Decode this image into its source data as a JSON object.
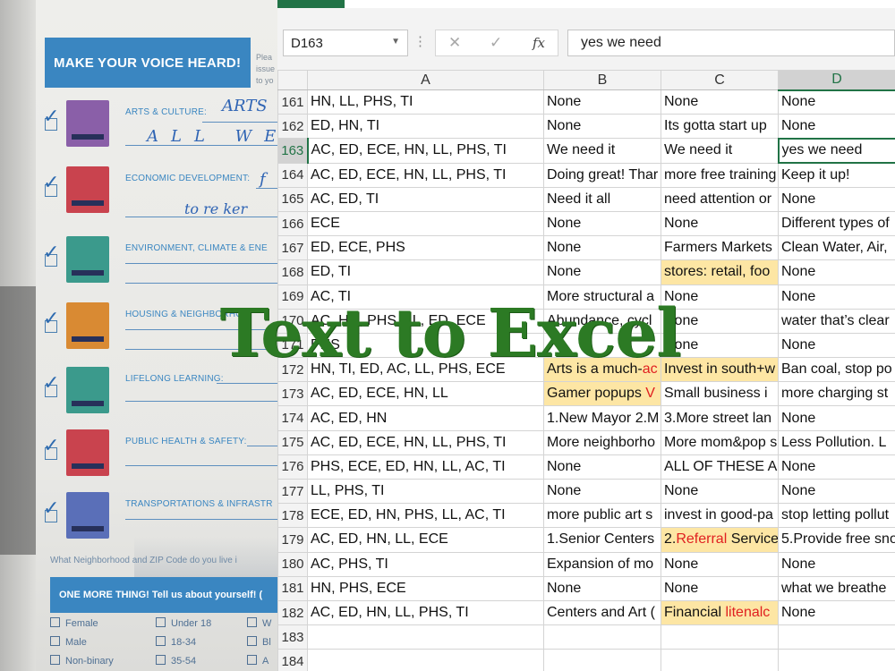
{
  "form": {
    "header": "MAKE YOUR VOICE HEARD!",
    "header_note": [
      "Plea",
      "issue",
      "to yo"
    ],
    "categories": [
      {
        "label": "ARTS & CULTURE:",
        "color": "#8a5fa8",
        "handwriting": [
          "ARTS",
          "ALL WE"
        ]
      },
      {
        "label": "ECONOMIC DEVELOPMENT:",
        "color": "#c9434e",
        "handwriting": [
          "f",
          "to re ker"
        ]
      },
      {
        "label": "ENVIRONMENT, CLIMATE & ENE",
        "color": "#3b9a8c",
        "handwriting": []
      },
      {
        "label": "HOUSING & NEIGHBORHOO",
        "color": "#d98a33",
        "handwriting": []
      },
      {
        "label": "LIFELONG LEARNING:",
        "color": "#3b9a8c",
        "handwriting": []
      },
      {
        "label": "PUBLIC HEALTH & SAFETY:",
        "color": "#c9434e",
        "handwriting": []
      },
      {
        "label": "TRANSPORTATIONS & INFRASTR",
        "color": "#5a6fb8",
        "handwriting": []
      }
    ],
    "zip_question": "What Neighborhood and ZIP Code do you live i",
    "more_bar": "ONE MORE THING! Tell us about yourself! (",
    "options": {
      "col1": [
        "Female",
        "Male",
        "Non-binary"
      ],
      "col2": [
        "Under 18",
        "18-34",
        "35-54"
      ],
      "col3": [
        "W",
        "Bl",
        "A"
      ]
    }
  },
  "spreadsheet": {
    "name_box": "D163",
    "formula_icons": {
      "cancel": "✕",
      "confirm": "✓",
      "fx": "fx"
    },
    "formula_value": "yes we need",
    "columns": [
      "A",
      "B",
      "C",
      "D"
    ],
    "selected_column": "D",
    "selected_row": "163",
    "rows": [
      {
        "num": "161",
        "cells": [
          "HN, LL, PHS, TI",
          "None",
          "None",
          "None"
        ]
      },
      {
        "num": "162",
        "cells": [
          "ED, HN, TI",
          "None",
          "Its gotta start up",
          "None"
        ]
      },
      {
        "num": "163",
        "cells": [
          "AC, ED, ECE, HN, LL, PHS, TI",
          "We need it",
          "We need it",
          "yes we need"
        ]
      },
      {
        "num": "164",
        "cells": [
          "AC, ED, ECE, HN, LL, PHS, TI",
          "Doing great! Thar",
          "more free training",
          "Keep it up!"
        ]
      },
      {
        "num": "165",
        "cells": [
          "AC, ED, TI",
          "Need it all",
          "need attention or",
          "None"
        ]
      },
      {
        "num": "166",
        "cells": [
          "ECE",
          "None",
          "None",
          "Different types of"
        ]
      },
      {
        "num": "167",
        "cells": [
          "ED, ECE, PHS",
          "None",
          "Farmers Markets",
          "Clean Water, Air,"
        ]
      },
      {
        "num": "168",
        "cells": [
          "ED, TI",
          "None",
          "stores: retail, foo",
          "None"
        ]
      },
      {
        "num": "169",
        "cells": [
          "AC, TI",
          "More structural a",
          "None",
          "None"
        ]
      },
      {
        "num": "170",
        "cells": [
          "AC, HN, PHS, LL, ED, ECE",
          "Abundance, cycl",
          "None",
          "water that’s clear"
        ]
      },
      {
        "num": "171",
        "cells": [
          "PHS",
          "",
          "None",
          "None"
        ]
      },
      {
        "num": "172",
        "cells": [
          "HN, TI, ED, AC, LL, PHS, ECE",
          "Arts is a much-",
          "Invest in south+w",
          "Ban coal, stop po"
        ]
      },
      {
        "num": "173",
        "cells": [
          "AC, ED, ECE, HN, LL",
          "Gamer popups ",
          "Small business i",
          "more charging st"
        ]
      },
      {
        "num": "174",
        "cells": [
          "AC, ED, HN",
          "1.New Mayor 2.M",
          "3.More street lan",
          "None"
        ]
      },
      {
        "num": "175",
        "cells": [
          "AC, ED, ECE, HN, LL, PHS, TI",
          "More neighborho",
          "More mom&pop s",
          "Less Pollution. L"
        ]
      },
      {
        "num": "176",
        "cells": [
          "PHS, ECE, ED, HN, LL, AC, TI",
          "None",
          "ALL OF THESE A",
          "None"
        ]
      },
      {
        "num": "177",
        "cells": [
          "LL, PHS, TI",
          "None",
          "None",
          "None"
        ]
      },
      {
        "num": "178",
        "cells": [
          "ECE, ED, HN, PHS, LL, AC, TI",
          "more public art s",
          "invest in good-pa",
          "stop letting pollut"
        ]
      },
      {
        "num": "179",
        "cells": [
          "AC, ED, HN, LL, ECE",
          "1.Senior Centers",
          "2.",
          "5.Provide free sno"
        ]
      },
      {
        "num": "180",
        "cells": [
          "AC, PHS, TI",
          "Expansion of mo",
          "None",
          "None"
        ]
      },
      {
        "num": "181",
        "cells": [
          "HN, PHS, ECE",
          "None",
          "None",
          "what we breathe"
        ]
      },
      {
        "num": "182",
        "cells": [
          "AC, ED, HN, LL, PHS, TI",
          "Centers and Art (",
          "Financial ",
          "None"
        ]
      },
      {
        "num": "183",
        "cells": [
          "",
          "",
          "",
          ""
        ]
      },
      {
        "num": "184",
        "cells": [
          "",
          "",
          "",
          ""
        ]
      }
    ],
    "red_fragments": {
      "r172b": "ac",
      "r173b": "V",
      "r179c": "Referral",
      "r179c_tail": " Service",
      "r182c": "litenalc"
    },
    "highlight_color": "#fde6a4",
    "accent_color": "#217346"
  },
  "overlay_title": "Text to Excel"
}
